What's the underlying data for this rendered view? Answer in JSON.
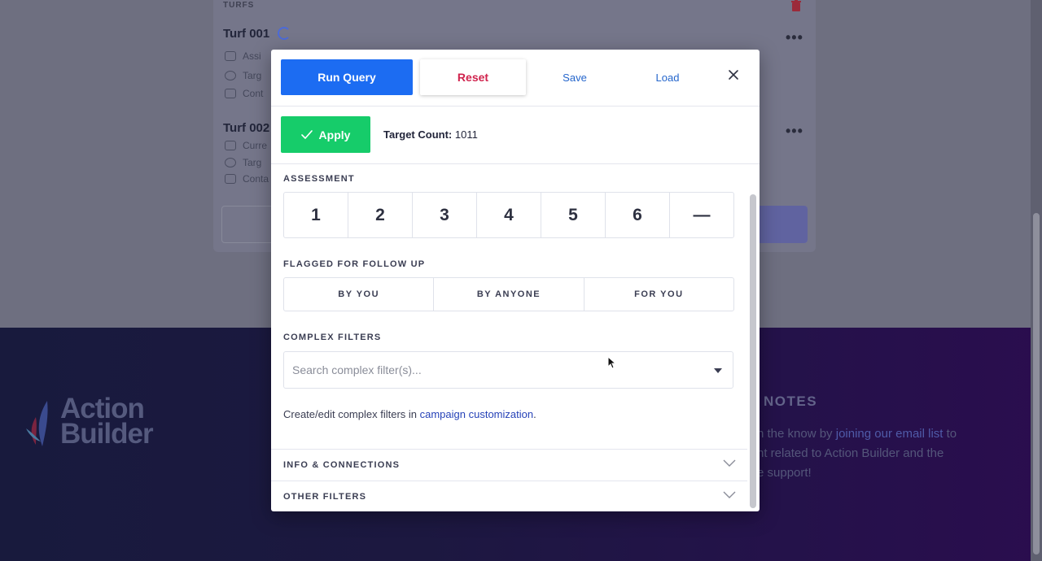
{
  "background": {
    "turfs_label": "TURFS",
    "turfs": [
      {
        "title": "Turf 001",
        "rows": [
          "Assi",
          "Targ",
          "Cont"
        ]
      },
      {
        "title": "Turf 002",
        "rows": [
          "Curre",
          "Targ",
          "Conta"
        ]
      }
    ],
    "footer": {
      "logo_line1": "Action",
      "logo_line2": "Builder",
      "heading": "D NOTES",
      "text_line1_pre": "n the know by ",
      "text_line1_link": "joining our email list",
      "text_line1_post": " to",
      "text_line2": "nt related to Action Builder and the",
      "text_line3": "e support!"
    }
  },
  "modal": {
    "header": {
      "run_query": "Run Query",
      "reset": "Reset",
      "save": "Save",
      "load": "Load"
    },
    "apply": {
      "label": "Apply",
      "target_count_label": "Target Count:",
      "target_count_value": "1011"
    },
    "assessment": {
      "label": "ASSESSMENT",
      "options": [
        "1",
        "2",
        "3",
        "4",
        "5",
        "6",
        "—"
      ]
    },
    "flagged": {
      "label": "FLAGGED FOR FOLLOW UP",
      "options": [
        "BY YOU",
        "BY ANYONE",
        "FOR YOU"
      ]
    },
    "complex_filters": {
      "label": "COMPLEX FILTERS",
      "placeholder": "Search complex filter(s)...",
      "help_pre": "Create/edit complex filters in ",
      "help_link": "campaign customization",
      "help_post": "."
    },
    "accordions": [
      "INFO & CONNECTIONS",
      "OTHER FILTERS"
    ]
  },
  "colors": {
    "primary": "#1c6cf2",
    "reset": "#d0234d",
    "apply": "#16cc6a",
    "link": "#2743b8"
  }
}
